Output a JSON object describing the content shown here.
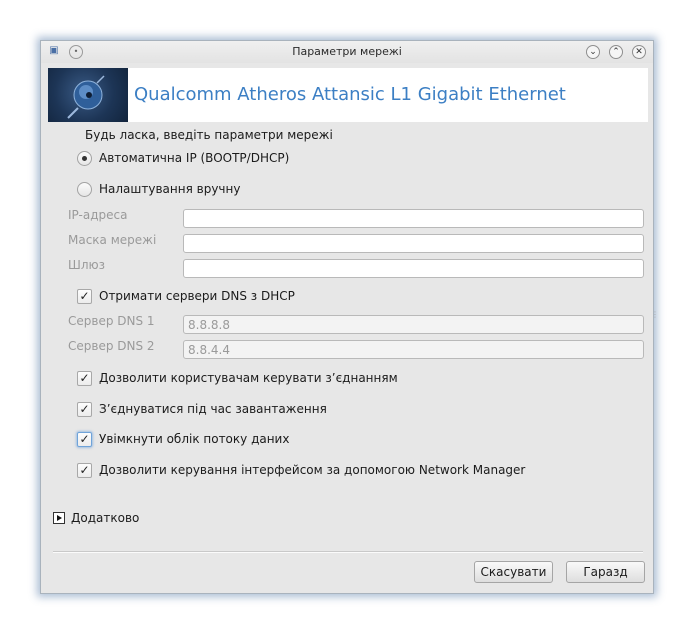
{
  "window": {
    "title": "Параметри мережі"
  },
  "banner": {
    "title": "Qualcomm Atheros Attansic L1 Gigabit Ethernet"
  },
  "form": {
    "prompt": "Будь ласка, введіть параметри мережі",
    "radio_auto": {
      "label": "Автоматична IP (BOOTP/DHCP)",
      "selected": true
    },
    "radio_manual": {
      "label": "Налаштування вручну",
      "selected": false
    },
    "ip_label": "IP-адреса",
    "ip_value": "",
    "mask_label": "Маска мережі",
    "mask_value": "",
    "gateway_label": "Шлюз",
    "gateway_value": "",
    "dns_from_dhcp": {
      "label": "Отримати сервери DNS з DHCP",
      "checked": true
    },
    "dns1_label": "Сервер DNS 1",
    "dns1_value": "8.8.8.8",
    "dns2_label": "Сервер DNS 2",
    "dns2_value": "8.8.4.4",
    "allow_users": {
      "label": "Дозволити користувачам керувати з’єднанням",
      "checked": true
    },
    "connect_on_boot": {
      "label": "З’єднуватися під час завантаження",
      "checked": true
    },
    "traffic_accounting": {
      "label": "Увімкнути облік потоку даних",
      "checked": true
    },
    "network_manager": {
      "label": "Дозволити керування інтерфейсом за допомогою Network Manager",
      "checked": true
    }
  },
  "advanced": {
    "label": "Додатково"
  },
  "buttons": {
    "cancel": "Скасувати",
    "ok": "Гаразд"
  },
  "icons": {
    "check_glyph": "✓",
    "close_glyph": "✕",
    "max_glyph": "⌃",
    "min_glyph": "⌄"
  }
}
